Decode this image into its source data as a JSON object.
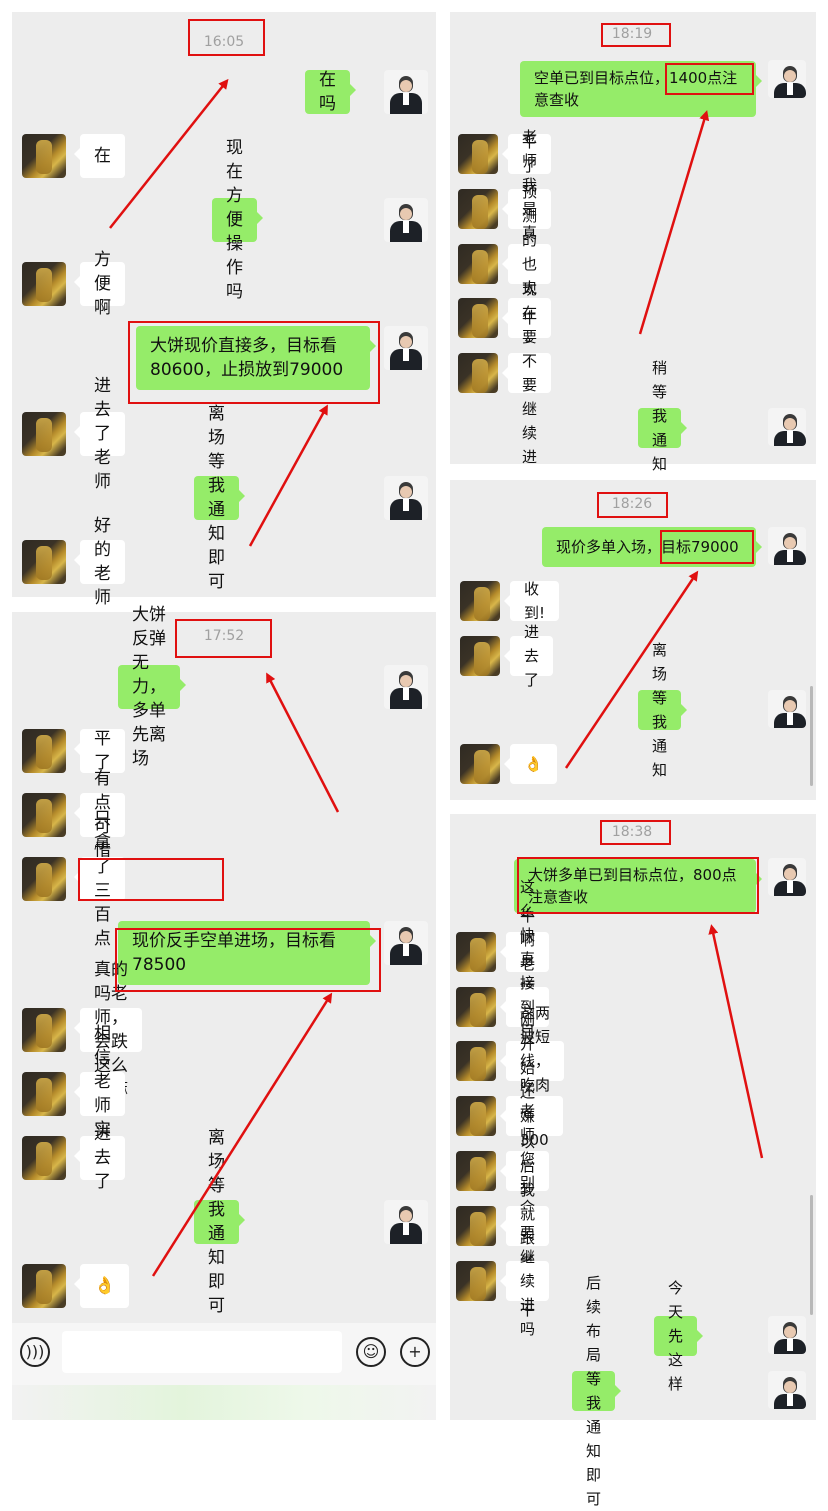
{
  "panel1": {
    "time": "16:05",
    "messages": [
      {
        "from": "me",
        "text": "在吗"
      },
      {
        "from": "them",
        "text": "在"
      },
      {
        "from": "me",
        "text": "现在方便操作吗"
      },
      {
        "from": "them",
        "text": "方便啊"
      },
      {
        "from": "me",
        "text": "大饼现价直接多，目标看\n80600，止损放到79000"
      },
      {
        "from": "them",
        "text": "进去了老师"
      },
      {
        "from": "me",
        "text": "离场等我通知即可"
      },
      {
        "from": "them",
        "text": "好的老师"
      }
    ]
  },
  "panel2": {
    "time": "17:52",
    "messages": [
      {
        "from": "me",
        "text": "大饼反弹无力，多单先离场"
      },
      {
        "from": "them",
        "text": "平了"
      },
      {
        "from": "them",
        "text": "有点可惜"
      },
      {
        "from": "them",
        "text": "只拿了三百点"
      },
      {
        "from": "me",
        "text": "现价反手空单进场，目标看\n78500"
      },
      {
        "from": "them",
        "text": "真的吗老师，会跌这么多嘛"
      },
      {
        "from": "them",
        "text": "相信老师实力"
      },
      {
        "from": "them",
        "text": "进去了"
      },
      {
        "from": "me",
        "text": "离场等我通知即可"
      },
      {
        "from": "them",
        "text": "👌"
      }
    ],
    "input_bar": {
      "voice_icon": "voice-icon",
      "emoji_icon": "emoji-icon",
      "plus_icon": "plus-icon"
    }
  },
  "panel3": {
    "time": "18:19",
    "messages": [
      {
        "from": "me",
        "text": "空单已到目标点位，1400点注\n意查收"
      },
      {
        "from": "them",
        "text": "平了"
      },
      {
        "from": "them",
        "text": "老师我是真服了"
      },
      {
        "from": "them",
        "text": "预测的也太准了"
      },
      {
        "from": "them",
        "text": "牛"
      },
      {
        "from": "them",
        "text": "现在要不要继续进"
      },
      {
        "from": "me",
        "text": "稍等我通知你"
      }
    ]
  },
  "panel4": {
    "time": "18:26",
    "messages": [
      {
        "from": "me",
        "text": "现价多单入场，目标79000"
      },
      {
        "from": "them",
        "text": "收到!"
      },
      {
        "from": "them",
        "text": "进去了"
      },
      {
        "from": "me",
        "text": "离场等我通知"
      },
      {
        "from": "them",
        "text": "👌"
      }
    ]
  },
  "panel5": {
    "time": "18:38",
    "messages": [
      {
        "from": "me",
        "text": "大饼多单已到目标点位，800点\n注意查收"
      },
      {
        "from": "them",
        "text": "牛啊老师"
      },
      {
        "from": "them",
        "text": "这么快直接到目标点位了"
      },
      {
        "from": "them",
        "text": "这两波短线，吃肉了"
      },
      {
        "from": "them",
        "text": "刚开始还嫌300点少😭"
      },
      {
        "from": "them",
        "text": "老师您别介意"
      },
      {
        "from": "them",
        "text": "以后我就跟老师干"
      },
      {
        "from": "them",
        "text": "要继续进吗"
      },
      {
        "from": "me",
        "text": "今天先这样"
      },
      {
        "from": "me",
        "text": "后续布局等我通知即可"
      }
    ]
  },
  "colors": {
    "my_bubble": "#95ec69",
    "their_bubble": "#ffffff",
    "chat_background": "#ededed",
    "annotation_red": "#e01010"
  }
}
